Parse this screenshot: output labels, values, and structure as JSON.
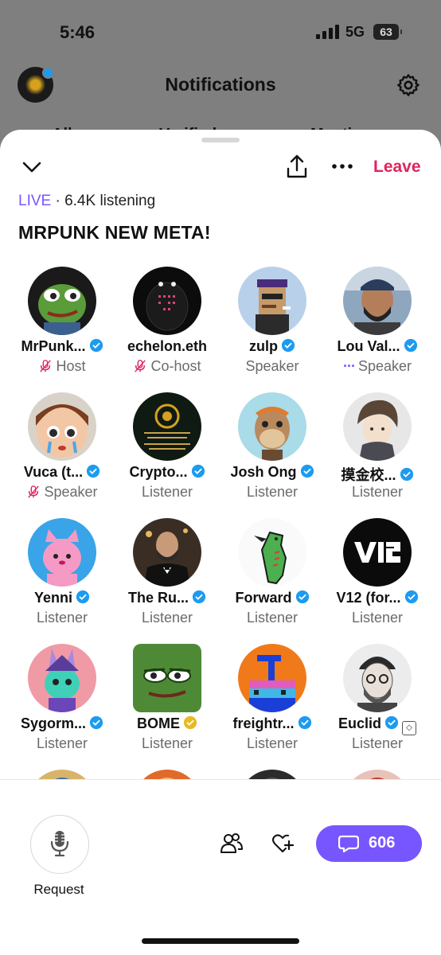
{
  "status_bar": {
    "time": "5:46",
    "network": "5G",
    "battery": "63"
  },
  "background": {
    "title": "Notifications",
    "tabs": [
      "All",
      "Verified",
      "Mentions"
    ]
  },
  "header": {
    "leave_label": "Leave"
  },
  "space": {
    "live_label": "LIVE",
    "listening": " · 6.4K listening",
    "title": "MRPUNK NEW META!"
  },
  "participants": [
    {
      "name": "MrPunk...",
      "role": "Host",
      "verified": "blue",
      "role_icon": "mic-off"
    },
    {
      "name": "echelon.eth",
      "role": "Co-host",
      "verified": "",
      "role_icon": "mic-off"
    },
    {
      "name": "zulp",
      "role": "Speaker",
      "verified": "blue",
      "role_icon": ""
    },
    {
      "name": "Lou Val...",
      "role": "Speaker",
      "verified": "blue",
      "role_icon": "dots"
    },
    {
      "name": "Vuca (t...",
      "role": "Speaker",
      "verified": "blue",
      "role_icon": "mic-off"
    },
    {
      "name": "Crypto...",
      "role": "Listener",
      "verified": "blue",
      "role_icon": ""
    },
    {
      "name": "Josh Ong",
      "role": "Listener",
      "verified": "blue",
      "role_icon": ""
    },
    {
      "name": "摸金校...",
      "role": "Listener",
      "verified": "blue",
      "role_icon": ""
    },
    {
      "name": "Yenni",
      "role": "Listener",
      "verified": "blue",
      "role_icon": ""
    },
    {
      "name": "The Ru...",
      "role": "Listener",
      "verified": "blue",
      "role_icon": ""
    },
    {
      "name": "Forward",
      "role": "Listener",
      "verified": "blue",
      "role_icon": ""
    },
    {
      "name": "V12 (for...",
      "role": "Listener",
      "verified": "blue",
      "role_icon": ""
    },
    {
      "name": "Sygorm...",
      "role": "Listener",
      "verified": "blue",
      "role_icon": ""
    },
    {
      "name": "BOME",
      "role": "Listener",
      "verified": "gold",
      "role_icon": ""
    },
    {
      "name": "freightr...",
      "role": "Listener",
      "verified": "blue",
      "role_icon": ""
    },
    {
      "name": "Euclid",
      "role": "Listener",
      "verified": "blue",
      "role_icon": "square"
    }
  ],
  "bottom_bar": {
    "request_label": "Request",
    "comment_count": "606"
  },
  "colors": {
    "accent": "#7856ff",
    "leave": "#e0245e",
    "verified_blue": "#1d9bf0",
    "verified_gold": "#e8b923",
    "mic_off": "#e0245e"
  }
}
